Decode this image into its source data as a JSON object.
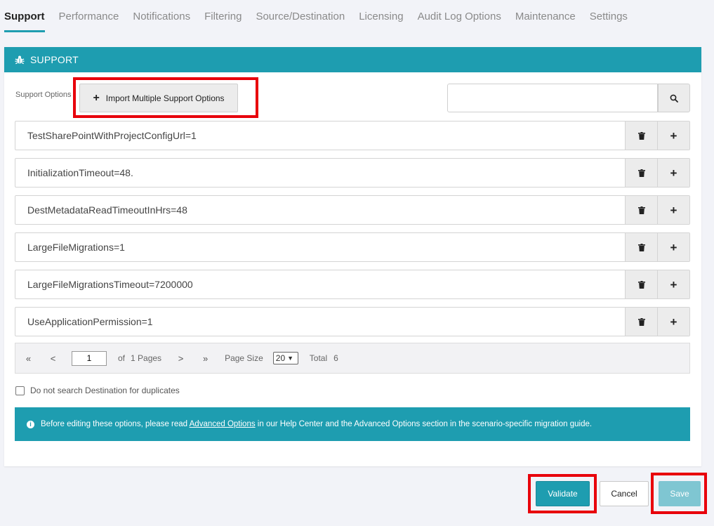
{
  "tabs": [
    {
      "label": "Support",
      "active": true
    },
    {
      "label": "Performance",
      "active": false
    },
    {
      "label": "Notifications",
      "active": false
    },
    {
      "label": "Filtering",
      "active": false
    },
    {
      "label": "Source/Destination",
      "active": false
    },
    {
      "label": "Licensing",
      "active": false
    },
    {
      "label": "Audit Log Options",
      "active": false
    },
    {
      "label": "Maintenance",
      "active": false
    },
    {
      "label": "Settings",
      "active": false
    }
  ],
  "panel": {
    "title": "SUPPORT",
    "icon": "bug-icon",
    "options_label": "Support Options",
    "import_button_label": "Import Multiple Support Options",
    "search": {
      "value": "",
      "placeholder": ""
    }
  },
  "options": [
    "TestSharePointWithProjectConfigUrl=1",
    "InitializationTimeout=48.",
    "DestMetadataReadTimeoutInHrs=48",
    "LargeFileMigrations=1",
    "LargeFileMigrationsTimeout=7200000",
    "UseApplicationPermission=1"
  ],
  "pager": {
    "first": "«",
    "prev": "<",
    "current_page": "1",
    "of_label": "of",
    "pages_label": "1 Pages",
    "next": ">",
    "last": "»",
    "page_size_label": "Page Size",
    "page_size": "20",
    "total_label": "Total",
    "total": "6"
  },
  "checkbox_label": "Do not search Destination for duplicates",
  "info": {
    "before": "Before editing these options, please read ",
    "link": "Advanced Options",
    "after": " in our Help Center and the Advanced Options section in the scenario-specific migration guide."
  },
  "footer": {
    "validate": "Validate",
    "cancel": "Cancel",
    "save": "Save"
  },
  "colors": {
    "accent": "#1e9db0",
    "highlight": "#e8000b",
    "save_disabled": "#7fc6d2"
  }
}
